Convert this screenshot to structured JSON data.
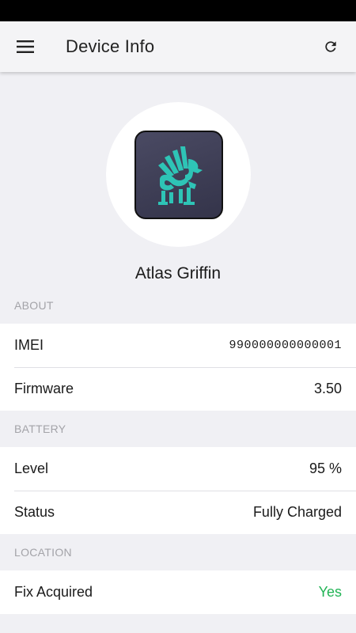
{
  "app_bar": {
    "title": "Device Info",
    "menu_icon": "hamburger-menu-icon",
    "refresh_icon": "refresh-icon"
  },
  "device": {
    "name": "Atlas Griffin",
    "logo_icon": "griffin-logo-icon",
    "logo_color": "#2ec4b6"
  },
  "sections": {
    "about": {
      "header": "ABOUT",
      "imei_label": "IMEI",
      "imei_value": "990000000000001",
      "firmware_label": "Firmware",
      "firmware_value": "3.50"
    },
    "battery": {
      "header": "BATTERY",
      "level_label": "Level",
      "level_value": "95 %",
      "status_label": "Status",
      "status_value": "Fully Charged"
    },
    "location": {
      "header": "LOCATION",
      "fix_label": "Fix Acquired",
      "fix_value": "Yes",
      "fix_color": "#22b455"
    }
  }
}
